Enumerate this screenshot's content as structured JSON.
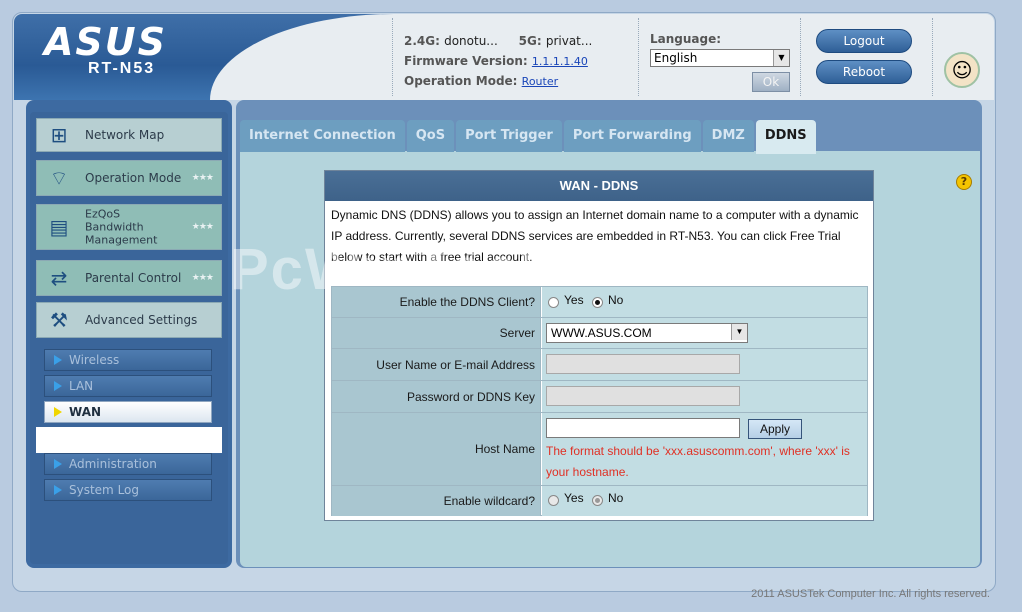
{
  "header": {
    "brand": "ASUS",
    "model": "RT-N53",
    "band_24_label": "2.4G:",
    "band_24_value": "donotu...",
    "band_5_label": "5G:",
    "band_5_value": "privat...",
    "firmware_label": "Firmware Version:",
    "firmware_value": "1.1.1.1.40",
    "opmode_label": "Operation Mode:",
    "opmode_value": "Router",
    "language_label": "Language:",
    "language_value": "English",
    "ok_label": "Ok",
    "logout_label": "Logout",
    "reboot_label": "Reboot"
  },
  "sidebar": {
    "items": [
      {
        "label": "Network Map",
        "icon": "network-map-icon"
      },
      {
        "label": "Operation Mode",
        "icon": "router-icon"
      },
      {
        "label": "EzQoS Bandwidth Management",
        "line1": "EzQoS",
        "line2": "Bandwidth",
        "line3": "Management",
        "icon": "qos-icon"
      },
      {
        "label": "Parental Control",
        "icon": "parental-icon"
      },
      {
        "label": "Advanced Settings",
        "icon": "tools-icon"
      }
    ],
    "sub_items": [
      {
        "label": "Wireless"
      },
      {
        "label": "LAN"
      },
      {
        "label": "WAN"
      },
      {
        "label": "Administration"
      },
      {
        "label": "System Log"
      }
    ],
    "active_sub": "WAN"
  },
  "tabs": [
    {
      "label": "Internet Connection"
    },
    {
      "label": "QoS"
    },
    {
      "label": "Port Trigger"
    },
    {
      "label": "Port Forwarding"
    },
    {
      "label": "DMZ"
    },
    {
      "label": "DDNS"
    }
  ],
  "active_tab": "DDNS",
  "panel": {
    "title": "WAN - DDNS",
    "description": "Dynamic DNS (DDNS) allows you to assign an Internet domain name to a computer with a dynamic IP address. Currently, several DDNS services are embedded in RT-N53. You can click Free Trial below to start with a free trial account.",
    "watermark": "PcWinTech.com"
  },
  "form": {
    "enable_label": "Enable the DDNS Client?",
    "enable_options": [
      "Yes",
      "No"
    ],
    "enable_selected": "No",
    "server_label": "Server",
    "server_value": "WWW.ASUS.COM",
    "username_label": "User Name or E-mail Address",
    "username_value": "",
    "password_label": "Password or DDNS Key",
    "password_value": "",
    "hostname_label": "Host Name",
    "hostname_value": "",
    "apply_label": "Apply",
    "hostname_hint": "The format should be 'xxx.asuscomm.com', where 'xxx' is your hostname.",
    "wildcard_label": "Enable wildcard?",
    "wildcard_options": [
      "Yes",
      "No"
    ],
    "wildcard_selected": "No"
  },
  "footer": "2011 ASUSTek Computer Inc. All rights reserved.",
  "help_icon": "?",
  "colors": {
    "accent": "#3d6aa1",
    "tab_active": "#d8eaf0",
    "hint_red": "#e03024"
  }
}
